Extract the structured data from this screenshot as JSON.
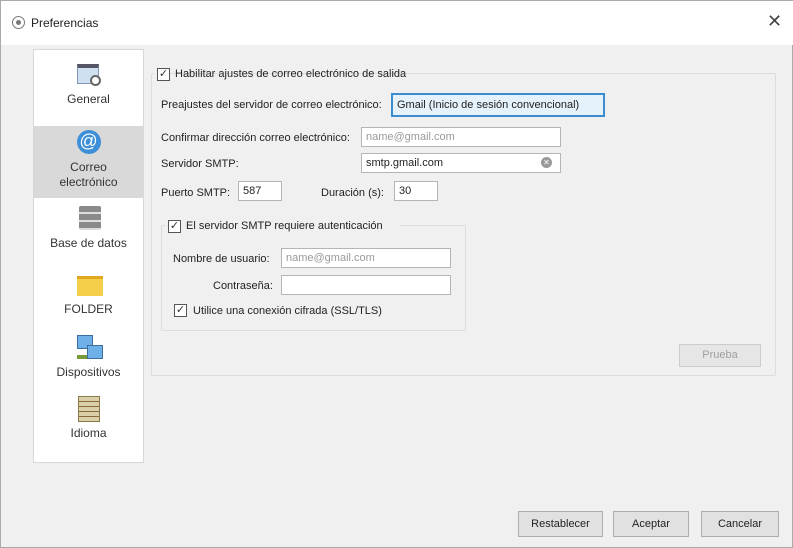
{
  "window": {
    "title": "Preferencias"
  },
  "sidebar": {
    "items": [
      {
        "label": "General",
        "icon": "general-settings-icon"
      },
      {
        "label": "Correo electrónico",
        "icon": "email-at-icon",
        "selected": true
      },
      {
        "label": "Base de datos",
        "icon": "database-icon"
      },
      {
        "label": "FOLDER",
        "icon": "folder-icon"
      },
      {
        "label": "Dispositivos",
        "icon": "devices-icon"
      },
      {
        "label": "Idioma",
        "icon": "language-icon"
      }
    ]
  },
  "email": {
    "enable_label": "Habilitar ajustes de correo electrónico de salida",
    "enable_checked": true,
    "preset_label": "Preajustes del servidor de correo electrónico:",
    "preset_value": "Gmail (Inicio de sesión convencional)",
    "confirm_label": "Confirmar dirección correo electrónico:",
    "confirm_placeholder": "name@gmail.com",
    "smtp_label": "Servidor SMTP:",
    "smtp_value": "smtp.gmail.com",
    "port_label": "Puerto SMTP:",
    "port_value": "587",
    "duration_label": "Duración (s):",
    "duration_value": "30",
    "auth_label": "El servidor SMTP requiere autenticación",
    "auth_checked": true,
    "user_label": "Nombre de usuario:",
    "user_placeholder": "name@gmail.com",
    "password_label": "Contraseña:",
    "password_value": "",
    "ssl_label": "Utilice una conexión cifrada (SSL/TLS)",
    "ssl_checked": true,
    "test_button": "Prueba"
  },
  "footer": {
    "reset": "Restablecer",
    "accept": "Aceptar",
    "cancel": "Cancelar"
  }
}
